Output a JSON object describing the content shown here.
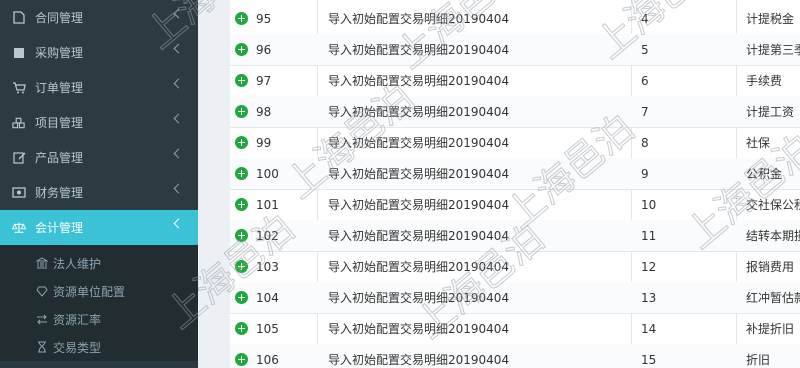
{
  "sidebar": {
    "items": [
      {
        "label": "合同管理",
        "icon": "file-icon"
      },
      {
        "label": "采购管理",
        "icon": "box-icon"
      },
      {
        "label": "订单管理",
        "icon": "cart-icon"
      },
      {
        "label": "项目管理",
        "icon": "cubes-icon"
      },
      {
        "label": "产品管理",
        "icon": "edit-icon"
      },
      {
        "label": "财务管理",
        "icon": "money-icon"
      },
      {
        "label": "会计管理",
        "icon": "balance-scale-icon",
        "active": true
      }
    ],
    "subitems": [
      {
        "label": "法人维护",
        "icon": "bank-icon"
      },
      {
        "label": "资源单位配置",
        "icon": "diamond-icon"
      },
      {
        "label": "资源汇率",
        "icon": "exchange-icon"
      },
      {
        "label": "交易类型",
        "icon": "hourglass-icon"
      }
    ]
  },
  "table": {
    "rows": [
      {
        "id": "95",
        "name": "导入初始配置交易明细20190404",
        "seq": "4",
        "type": "计提税金"
      },
      {
        "id": "96",
        "name": "导入初始配置交易明细20190404",
        "seq": "5",
        "type": "计提第三季"
      },
      {
        "id": "97",
        "name": "导入初始配置交易明细20190404",
        "seq": "6",
        "type": "手续费"
      },
      {
        "id": "98",
        "name": "导入初始配置交易明细20190404",
        "seq": "7",
        "type": "计提工资"
      },
      {
        "id": "99",
        "name": "导入初始配置交易明细20190404",
        "seq": "8",
        "type": "社保"
      },
      {
        "id": "100",
        "name": "导入初始配置交易明细20190404",
        "seq": "9",
        "type": "公积金"
      },
      {
        "id": "101",
        "name": "导入初始配置交易明细20190404",
        "seq": "10",
        "type": "交社保公积"
      },
      {
        "id": "102",
        "name": "导入初始配置交易明细20190404",
        "seq": "11",
        "type": "结转本期损"
      },
      {
        "id": "103",
        "name": "导入初始配置交易明细20190404",
        "seq": "12",
        "type": "报销费用"
      },
      {
        "id": "104",
        "name": "导入初始配置交易明细20190404",
        "seq": "13",
        "type": "红冲暂估款"
      },
      {
        "id": "105",
        "name": "导入初始配置交易明细20190404",
        "seq": "14",
        "type": "补提折旧"
      },
      {
        "id": "106",
        "name": "导入初始配置交易明细20190404",
        "seq": "15",
        "type": "折旧"
      }
    ]
  },
  "watermark": {
    "text": "上海邑泊"
  },
  "colors": {
    "sidebar_bg": "#2c3b41",
    "active": "#3cc2d6",
    "plus": "#1fa83c"
  }
}
